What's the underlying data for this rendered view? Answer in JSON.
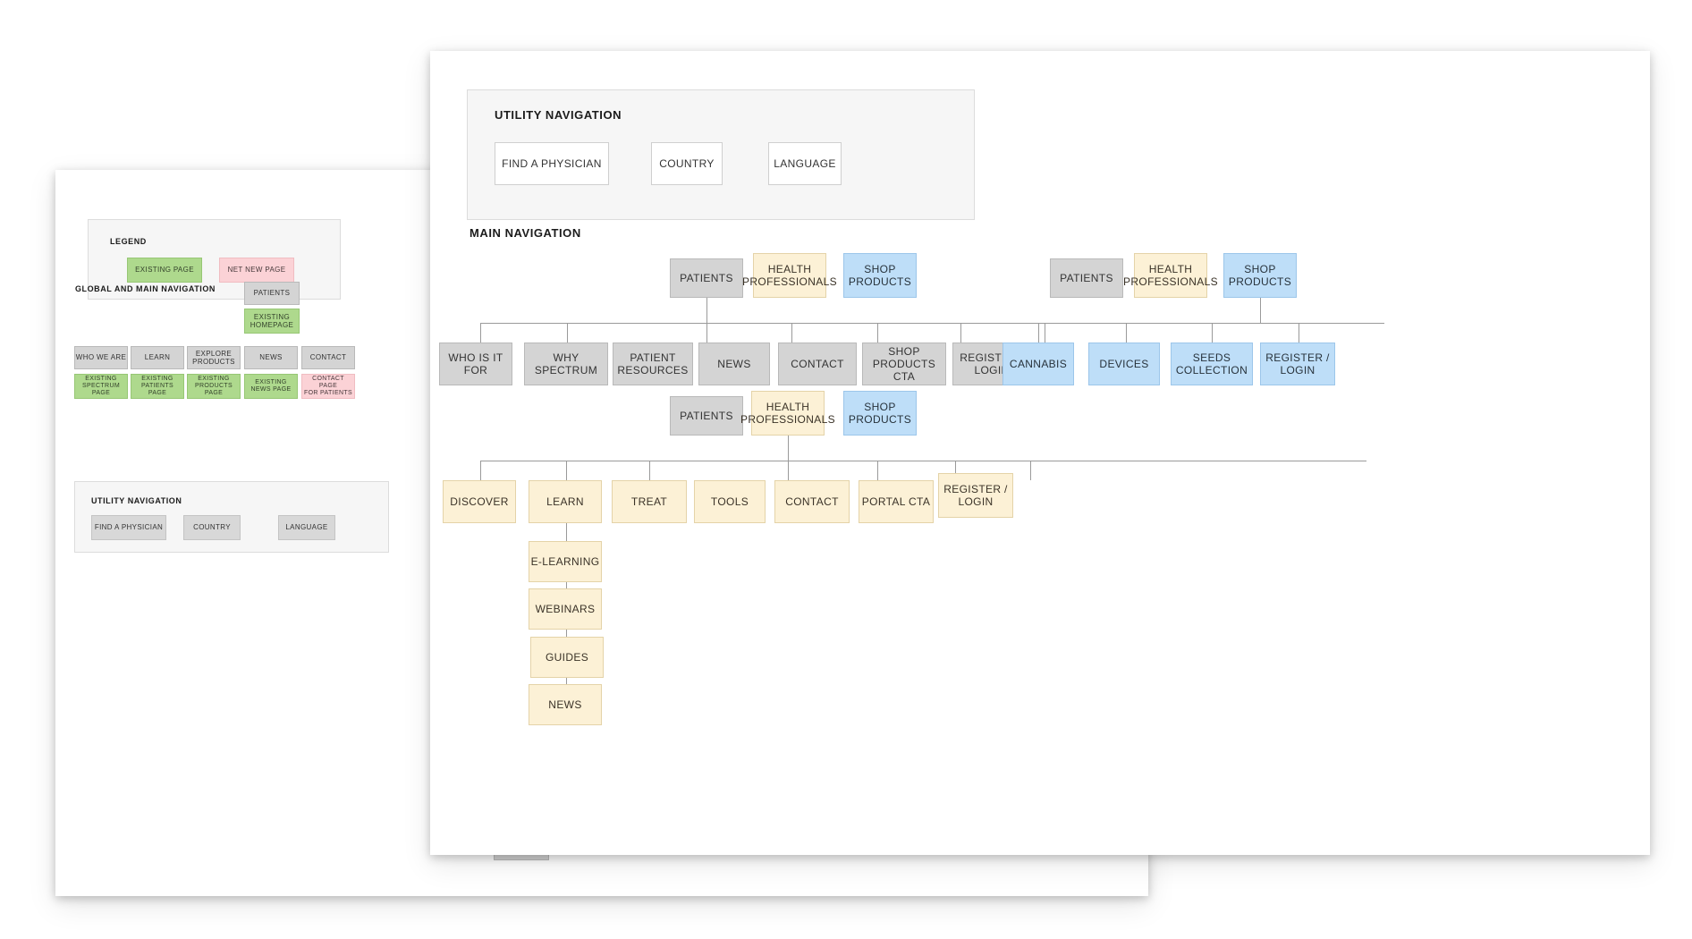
{
  "back_card": {
    "legend": {
      "title": "LEGEND",
      "items": [
        {
          "label": "EXISTING PAGE",
          "color": "#aed98d"
        },
        {
          "label": "NET NEW PAGE",
          "color": "#fbd2d6"
        }
      ]
    },
    "global_main_navigation": {
      "title": "GLOBAL AND MAIN NAVIGATION",
      "top_node": {
        "label": "PATIENTS",
        "color": "#d4d4d4"
      },
      "homepage_node": {
        "label": "EXISTING\nHOMEPAGE",
        "color": "#aed98d"
      },
      "columns": [
        {
          "nav": "WHO WE ARE",
          "page": "EXISTING\nSPECTRUM\nPAGE",
          "page_color": "#aed98d"
        },
        {
          "nav": "LEARN",
          "page": "EXISTING\nPATIENTS PAGE",
          "page_color": "#aed98d"
        },
        {
          "nav": "EXPLORE\nPRODUCTS",
          "page": "EXISTING\nPRODUCTS\nPAGE",
          "page_color": "#aed98d"
        },
        {
          "nav": "NEWS",
          "page": "EXISTING\nNEWS PAGE",
          "page_color": "#aed98d"
        },
        {
          "nav": "CONTACT",
          "page": "CONTACT PAGE\nFOR PATIENTS",
          "page_color": "#fbd2d6"
        }
      ]
    },
    "utility_navigation": {
      "title": "UTILITY NAVIGATION",
      "buttons": [
        "FIND A PHYSICIAN",
        "COUNTRY",
        "LANGUAGE"
      ]
    }
  },
  "front_card": {
    "utility_navigation": {
      "title": "UTILITY NAVIGATION",
      "buttons": [
        "FIND A PHYSICIAN",
        "COUNTRY",
        "LANGUAGE"
      ]
    },
    "main_navigation": {
      "title": "MAIN NAVIGATION",
      "tab_labels": {
        "patients": "PATIENTS",
        "health_professionals": "HEALTH\nPROFESSIONALS",
        "shop_products": "SHOP\nPRODUCTS"
      },
      "groups": [
        {
          "id": "patients-tree",
          "active_tab": "PATIENTS",
          "active_color": "#d4d4d4",
          "children": [
            "WHO IS IT FOR",
            "WHY\nSPECTRUM",
            "PATIENT\nRESOURCES",
            "NEWS",
            "CONTACT",
            "SHOP PRODUCTS\nCTA",
            "REGISTER /\nLOGIN"
          ]
        },
        {
          "id": "shop-products-tree",
          "active_tab": "SHOP PRODUCTS",
          "active_color": "#bedef8",
          "children": [
            "CANNABIS",
            "DEVICES",
            "SEEDS\nCOLLECTION",
            "REGISTER /\nLOGIN"
          ]
        },
        {
          "id": "health-professionals-tree",
          "active_tab": "HEALTH PROFESSIONALS",
          "active_color": "#fcf1d6",
          "children": [
            "DISCOVER",
            "LEARN",
            "TREAT",
            "TOOLS",
            "CONTACT",
            "PORTAL CTA",
            "REGISTER /\nLOGIN"
          ],
          "learn_subtree": [
            "E-LEARNING",
            "WEBINARS",
            "GUIDES",
            "NEWS"
          ]
        }
      ]
    }
  }
}
